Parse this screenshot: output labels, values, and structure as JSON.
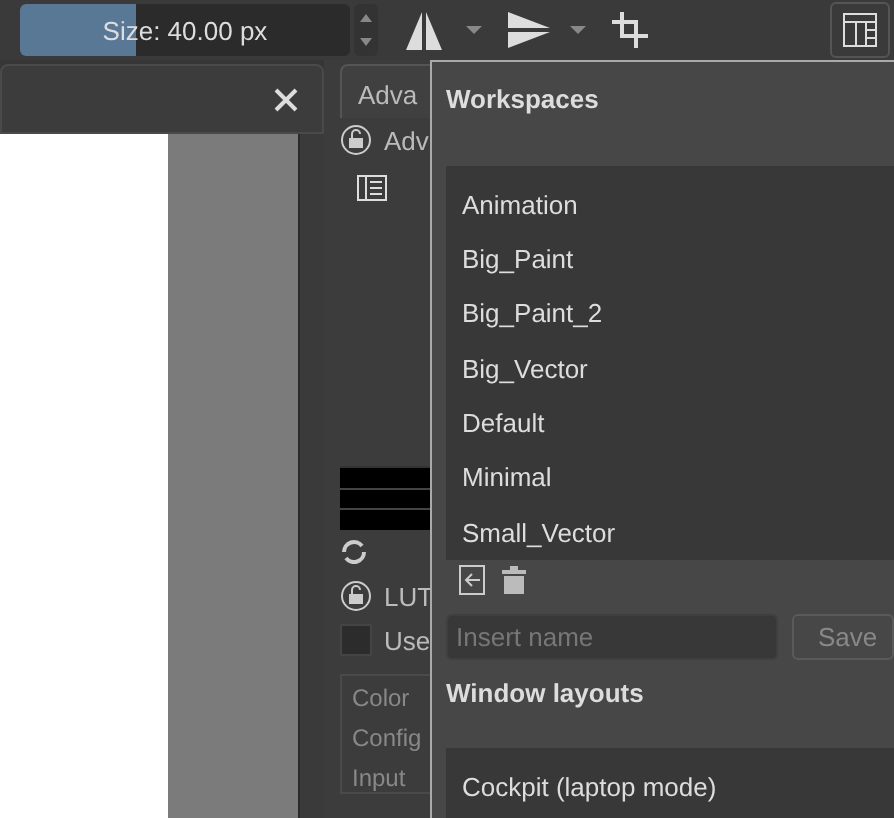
{
  "toolbar": {
    "size_slider": {
      "label": "Size: 40.00 px",
      "level": 0.35
    }
  },
  "panel": {
    "tab": "Adva",
    "lock_label": "Adv",
    "lut_label": "LUT",
    "use_checkbox": {
      "label": "Use",
      "checked": false
    },
    "rows": [
      "Color",
      "Config",
      "Input"
    ]
  },
  "workspaces": {
    "title": "Workspaces",
    "items": [
      {
        "label": "Animation",
        "selected": false
      },
      {
        "label": "Big_Paint",
        "selected": false
      },
      {
        "label": "Big_Paint_2",
        "selected": false
      },
      {
        "label": "Big_Vector",
        "selected": false
      },
      {
        "label": "Default",
        "selected": false
      },
      {
        "label": "Minimal",
        "selected": false
      },
      {
        "label": "Small_Vector",
        "selected": false
      }
    ],
    "name_field": {
      "placeholder": "Insert name"
    },
    "save_button": "Save"
  },
  "window_layouts": {
    "title": "Window layouts",
    "items": [
      {
        "label": "Cockpit (laptop mode)",
        "selected": false
      }
    ]
  }
}
